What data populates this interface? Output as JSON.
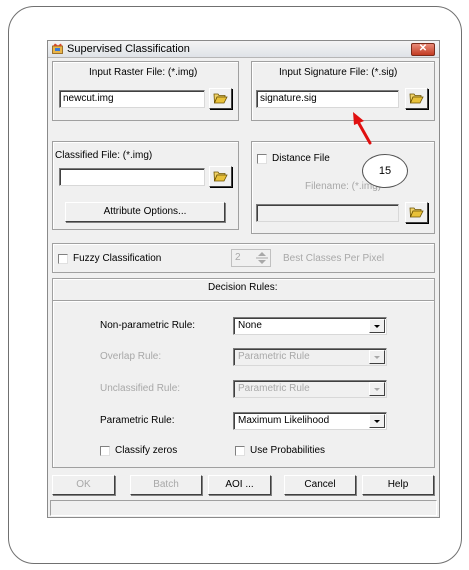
{
  "window": {
    "title": "Supervised Classification"
  },
  "input_raster": {
    "label": "Input Raster File: (*.img)",
    "value": "newcut.img"
  },
  "input_signature": {
    "label": "Input Signature File: (*.sig)",
    "value": "signature.sig"
  },
  "classified": {
    "label": "Classified File: (*.img)",
    "value": "",
    "attribute_button": "Attribute Options..."
  },
  "distance": {
    "checkbox_label": "Distance File",
    "filename_label": "Filename: (*.img)",
    "value": ""
  },
  "fuzzy": {
    "checkbox_label": "Fuzzy Classification",
    "best_classes_value": "2",
    "best_classes_label": "Best Classes Per Pixel"
  },
  "decision_rules": {
    "heading": "Decision Rules:",
    "non_parametric": {
      "label": "Non-parametric Rule:",
      "value": "None"
    },
    "overlap": {
      "label": "Overlap Rule:",
      "value": "Parametric Rule"
    },
    "unclassified": {
      "label": "Unclassified Rule:",
      "value": "Parametric Rule"
    },
    "parametric": {
      "label": "Parametric Rule:",
      "value": "Maximum Likelihood"
    },
    "classify_zeros": "Classify zeros",
    "use_probabilities": "Use Probabilities"
  },
  "buttons": {
    "ok": "OK",
    "batch": "Batch",
    "aoi": "AOI ...",
    "cancel": "Cancel",
    "help": "Help"
  },
  "annotation": {
    "number": "15",
    "arrow_color": "#e01010"
  },
  "colors": {
    "dialog_bg": "#f0f0f0",
    "close_button": "#c23b22",
    "folder_icon": "#e8c13a"
  }
}
